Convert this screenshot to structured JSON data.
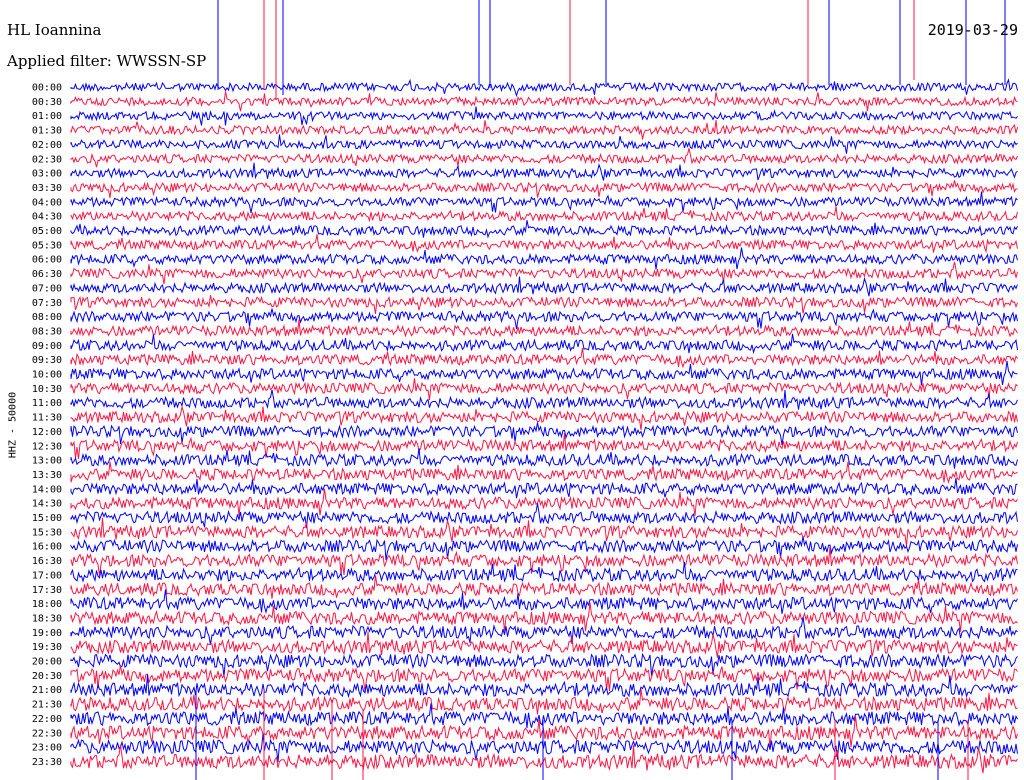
{
  "header": {
    "station": "HL Ioannina",
    "filter": "Applied filter: WWSSN-SP",
    "date": "2019-03-29",
    "channel": "HHZ - 50000"
  },
  "colors": {
    "blue": "#0000ff",
    "red": "#ff1744",
    "text": "#000000"
  },
  "chart_data": {
    "type": "line",
    "title": "HL Ioannina",
    "subtitle": "Applied filter: WWSSN-SP",
    "ylabel": "HHZ - 50000",
    "series_colors": [
      "#0000ff",
      "#ff1744"
    ],
    "row_labels": [
      "00:00",
      "00:30",
      "01:00",
      "01:30",
      "02:00",
      "02:30",
      "03:00",
      "03:30",
      "04:00",
      "04:30",
      "05:00",
      "05:30",
      "06:00",
      "06:30",
      "07:00",
      "07:30",
      "08:00",
      "08:30",
      "09:00",
      "09:30",
      "10:00",
      "10:30",
      "11:00",
      "11:30",
      "12:00",
      "12:30",
      "13:00",
      "13:30",
      "14:00",
      "14:30",
      "15:00",
      "15:30",
      "16:00",
      "16:30",
      "17:00",
      "17:30",
      "18:00",
      "18:30",
      "19:00",
      "19:30",
      "20:00",
      "20:30",
      "21:00",
      "21:30",
      "22:00",
      "22:30",
      "23:00",
      "23:30"
    ]
  }
}
